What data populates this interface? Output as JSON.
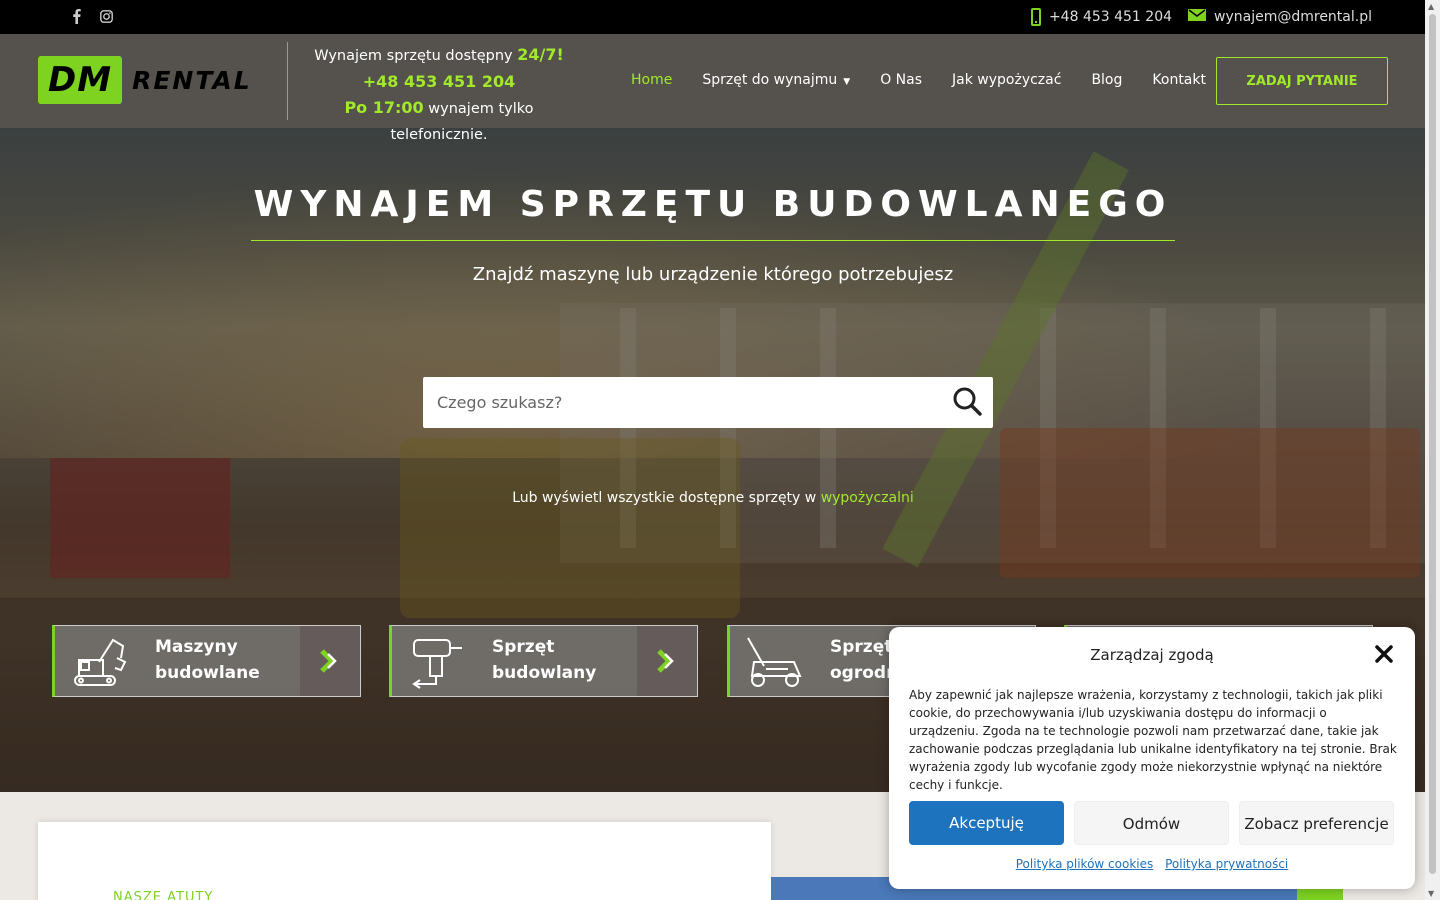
{
  "topbar": {
    "social": [
      "facebook-icon",
      "instagram-icon"
    ],
    "phone": "+48 453 451 204",
    "email": "wynajem@dmrental.pl"
  },
  "header": {
    "logo_dm": "DM",
    "logo_rental": "RENTAL",
    "avail_line1_prefix": "Wynajem sprzętu dostępny ",
    "avail_line1_highlight": "24/7!",
    "avail_phone": "+48 453 451 204",
    "avail_line3_highlight": "Po 17:00",
    "avail_line3_suffix": " wynajem tylko telefonicznie.",
    "nav": {
      "home": "Home",
      "equipment": "Sprzęt do wynajmu",
      "about": "O Nas",
      "howto": "Jak wypożyczać",
      "blog": "Blog",
      "contact": "Kontakt"
    },
    "ask_button": "ZADAJ PYTANIE"
  },
  "hero": {
    "title": "WYNAJEM SPRZĘTU BUDOWLANEGO",
    "subtitle": "Znajdź maszynę lub urządzenie którego potrzebujesz",
    "search_placeholder": "Czego szukasz?",
    "browse_prefix": "Lub wyświetl wszystkie dostępne sprzęty w ",
    "browse_link": "wypożyczalni",
    "categories": [
      {
        "label1": "Maszyny",
        "label2": "budowlane",
        "icon": "excavator-icon"
      },
      {
        "label1": "Sprzęt",
        "label2": "budowlany",
        "icon": "drill-icon"
      },
      {
        "label1": "Sprzęt",
        "label2": "ogrodn",
        "icon": "lawnmower-icon"
      }
    ]
  },
  "lower": {
    "section_label": "NASZE ATUTY"
  },
  "cookie": {
    "title": "Zarządzaj zgodą",
    "text": "Aby zapewnić jak najlepsze wrażenia, korzystamy z technologii, takich jak pliki cookie, do przechowywania i/lub uzyskiwania dostępu do informacji o urządzeniu. Zgoda na te technologie pozwoli nam przetwarzać dane, takie jak zachowanie podczas przeglądania lub unikalne identyfikatory na tej stronie. Brak wyrażenia zgody lub wycofanie zgody może niekorzystnie wpłynąć na niektóre cechy i funkcje.",
    "accept": "Akceptuję",
    "deny": "Odmów",
    "prefs": "Zobacz preferencje",
    "link_cookies": "Polityka plików cookies",
    "link_privacy": "Polityka prywatności"
  },
  "colors": {
    "accent_green": "#a0ea2a",
    "logo_green": "#7ed321",
    "accept_blue": "#1e73be"
  }
}
